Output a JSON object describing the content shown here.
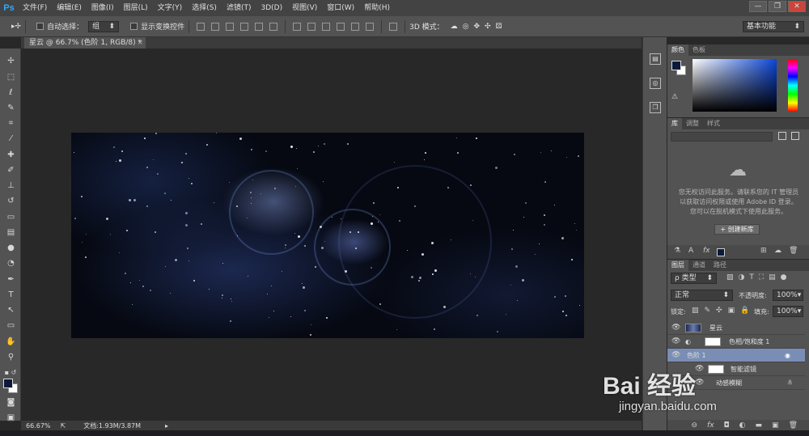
{
  "app": {
    "logo": "Ps"
  },
  "menu": [
    "文件(F)",
    "编辑(E)",
    "图像(I)",
    "图层(L)",
    "文字(Y)",
    "选择(S)",
    "滤镜(T)",
    "3D(D)",
    "视图(V)",
    "窗口(W)",
    "帮助(H)"
  ],
  "window_controls": {
    "minimize": "—",
    "maximize": "❐",
    "close": "✕"
  },
  "options": {
    "auto_select_label": "自动选择：",
    "auto_select_value": "组",
    "show_transform_label": "显示变换控件",
    "mode_3d_label": "3D 模式：",
    "workspace_value": "基本功能"
  },
  "document": {
    "tab_title": "星云 @ 66.7% (色阶 1, RGB/8) *",
    "close": "×"
  },
  "status": {
    "zoom": "66.67%",
    "doc_info": "文档:1.93M/3.87M"
  },
  "color_panel": {
    "tabs": [
      "颜色",
      "色板"
    ],
    "fg_color": "#0b1a3a",
    "bg_color": "#ffffff"
  },
  "library_panel": {
    "tabs": [
      "库",
      "调整",
      "样式"
    ],
    "message": "您无权访问此服务。请联系您的 IT 管理员以获取访问权限或使用 Adobe ID 登录。您可以在脱机模式下使用此服务。",
    "create_button": "+ 创建新库"
  },
  "layers_panel": {
    "tabs": [
      "图层",
      "通道",
      "路径"
    ],
    "filter_kind": "ρ 类型",
    "blend_mode": "正常",
    "opacity_label": "不透明度:",
    "opacity_value": "100%",
    "lock_label": "锁定:",
    "fill_label": "填充:",
    "fill_value": "100%",
    "layers": [
      {
        "name": "星云"
      },
      {
        "name": "色相/饱和度 1"
      },
      {
        "name": "色阶 1"
      },
      {
        "name": "智能滤镜"
      },
      {
        "name": "动感模糊"
      }
    ],
    "footer_icons": [
      "link-icon",
      "fx-icon",
      "mask-icon",
      "adjustment-icon",
      "folder-icon",
      "new-layer-icon",
      "trash-icon"
    ]
  },
  "watermark": {
    "text": "Bai 经验",
    "url": "jingyan.baidu.com"
  }
}
